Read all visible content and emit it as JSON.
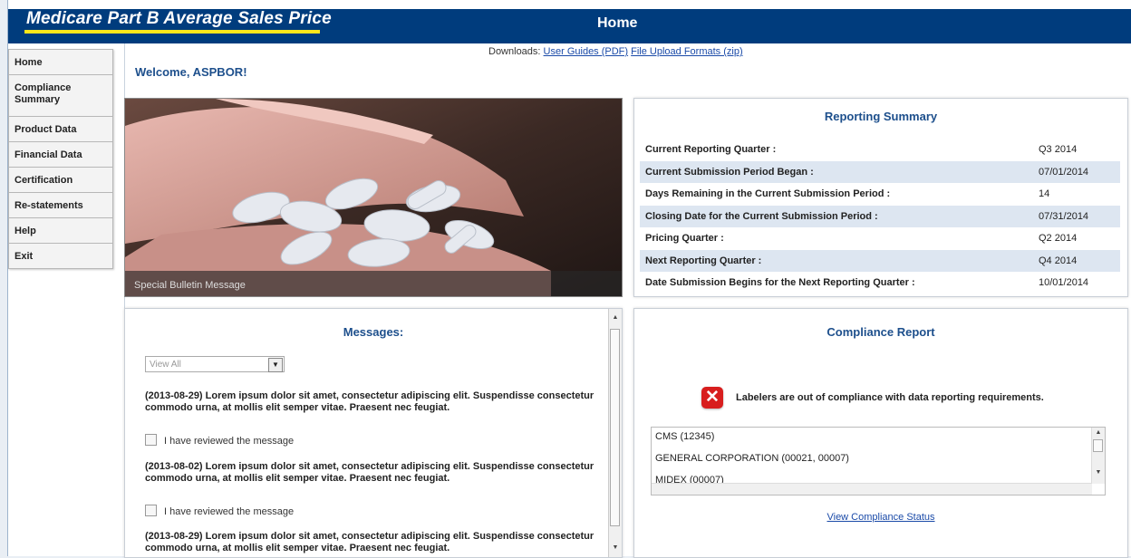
{
  "header": {
    "app_title": "Medicare Part B Average Sales Price",
    "page_title": "Home"
  },
  "sidebar": {
    "items": [
      {
        "label": "Home"
      },
      {
        "label": "Compliance Summary"
      },
      {
        "label": "Product Data"
      },
      {
        "label": "Financial Data"
      },
      {
        "label": "Certification"
      },
      {
        "label": "Re-statements"
      },
      {
        "label": "Help"
      },
      {
        "label": "Exit"
      }
    ]
  },
  "downloads": {
    "label": "Downloads:",
    "user_guides": "User Guides (PDF)",
    "file_formats": "File Upload Formats (zip)"
  },
  "welcome": "Welcome, ASPBOR!",
  "bulletin": {
    "caption": "Special Bulletin Message"
  },
  "reporting_summary": {
    "title": "Reporting Summary",
    "rows": [
      {
        "label": "Current Reporting Quarter :",
        "value": "Q3 2014"
      },
      {
        "label": "Current Submission Period Began :",
        "value": "07/01/2014"
      },
      {
        "label": "Days Remaining in the Current Submission Period :",
        "value": "14"
      },
      {
        "label": "Closing Date for the Current Submission Period :",
        "value": "07/31/2014"
      },
      {
        "label": "Pricing Quarter :",
        "value": "Q2 2014"
      },
      {
        "label": "Next Reporting Quarter :",
        "value": "Q4 2014"
      },
      {
        "label": "Date Submission Begins for the Next Reporting Quarter :",
        "value": "10/01/2014"
      }
    ]
  },
  "messages": {
    "title": "Messages:",
    "filter_value": "View All",
    "review_label": "I have reviewed the message",
    "items": [
      {
        "text": "(2013-08-29) Lorem ipsum dolor sit amet, consectetur adipiscing elit. Suspendisse consectetur commodo urna, at mollis elit semper vitae. Praesent nec feugiat."
      },
      {
        "text": "(2013-08-02) Lorem ipsum dolor sit amet, consectetur adipiscing elit. Suspendisse consectetur commodo urna, at mollis elit semper vitae. Praesent nec feugiat."
      },
      {
        "text": "(2013-08-29) Lorem ipsum dolor sit amet, consectetur adipiscing elit. Suspendisse consectetur commodo urna, at mollis elit semper vitae. Praesent nec feugiat."
      }
    ]
  },
  "compliance": {
    "title": "Compliance Report",
    "status_message": "Labelers are out of compliance with data reporting requirements.",
    "labelers": [
      "CMS (12345)",
      "GENERAL CORPORATION (00021, 00007)",
      "MIDEX (00007)"
    ],
    "view_link": "View Compliance Status"
  },
  "icons": {
    "error": "x-error-icon",
    "dropdown": "chevron-down-icon"
  },
  "colors": {
    "header_bg": "#003c7d",
    "title_underline": "#ffe61a",
    "heading_blue": "#1d4f8c",
    "alt_row": "#dde6f1",
    "error_red": "#d81e1e"
  }
}
